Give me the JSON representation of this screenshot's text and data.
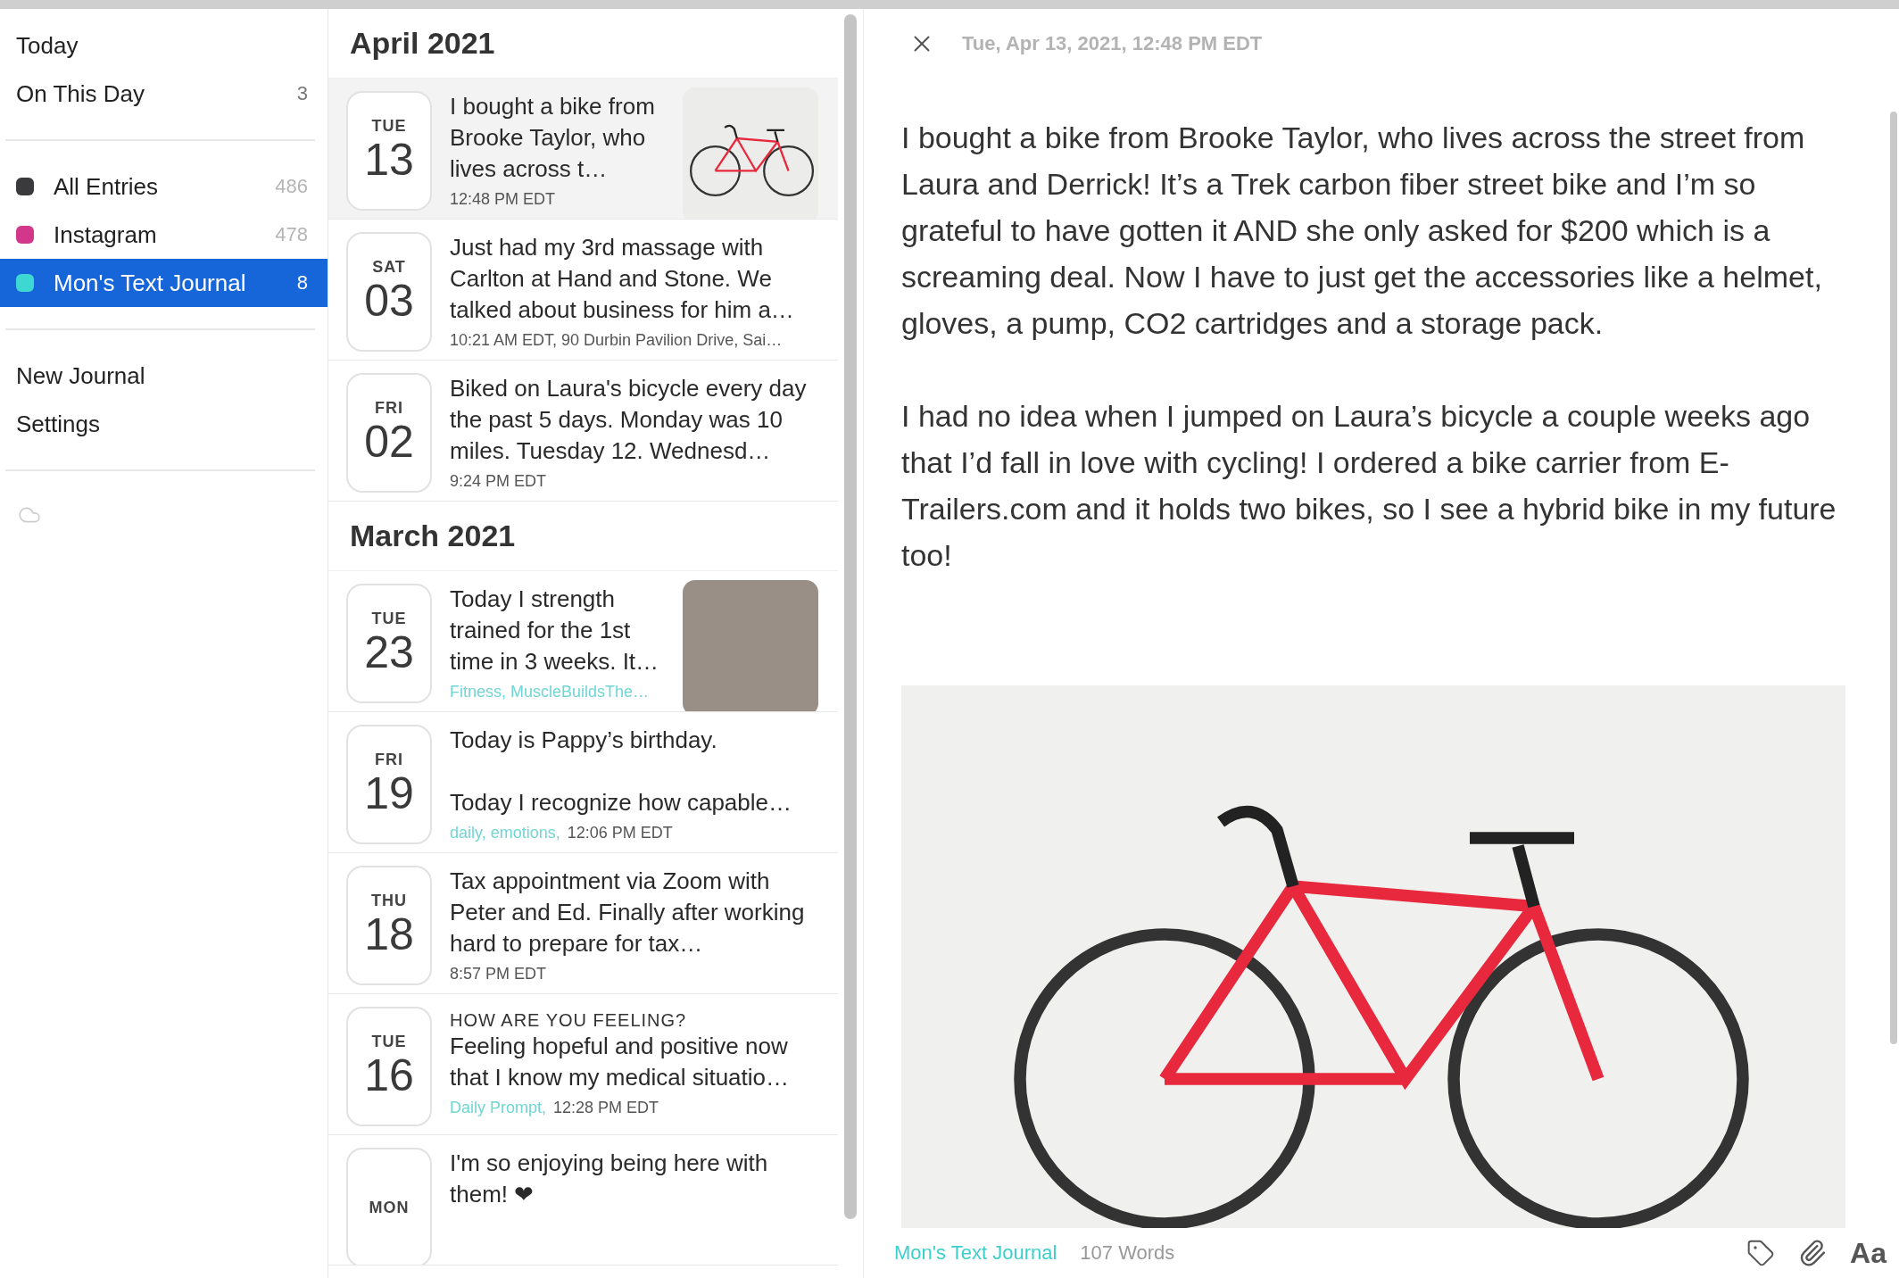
{
  "sidebar": {
    "top_items": [
      {
        "label": "Today"
      },
      {
        "label": "On This Day",
        "count": "3"
      }
    ],
    "journals": [
      {
        "name": "All Entries",
        "count": "486",
        "color": "#3a3a3c",
        "selected": false
      },
      {
        "name": "Instagram",
        "count": "478",
        "color": "#d2378c",
        "selected": false
      },
      {
        "name": "Mon's Text Journal",
        "count": "8",
        "color": "#3dd8d2",
        "selected": true
      }
    ],
    "actions": [
      {
        "label": "New Journal"
      },
      {
        "label": "Settings"
      }
    ]
  },
  "entry_list": {
    "sections": [
      {
        "month": "April 2021",
        "entries": [
          {
            "weekday": "TUE",
            "day": "13",
            "text": "I bought a bike from Brooke Taylor, who lives across t…",
            "meta": "12:48 PM EDT",
            "thumbnail": {
              "kind": "bike"
            },
            "selected": true
          },
          {
            "weekday": "SAT",
            "day": "03",
            "text": "Just had my 3rd massage with Carlton at Hand and Stone.  We talked about business for him a…",
            "meta": "10:21 AM EDT,  90 Durbin Pavilion Drive, Sai…",
            "selected": false
          },
          {
            "weekday": "FRI",
            "day": "02",
            "text": "Biked on Laura's bicycle every day the past 5 days. Monday was 10 miles. Tuesday 12. Wednesd…",
            "meta": "9:24 PM EDT",
            "selected": false
          }
        ]
      },
      {
        "month": "March 2021",
        "entries": [
          {
            "weekday": "TUE",
            "day": "23",
            "text": "Today I strength trained for the 1st time in 3 weeks. It…",
            "tags": "Fitness, MuscleBuildsThe…",
            "thumbnail": {
              "kind": "photo"
            },
            "selected": false
          },
          {
            "weekday": "FRI",
            "day": "19",
            "text": "Today is Pappy’s birthday.\n\nToday I recognize how capable…",
            "tags": "daily, emotions,",
            "meta": "12:06 PM EDT",
            "selected": false
          },
          {
            "weekday": "THU",
            "day": "18",
            "text": "Tax appointment via Zoom with Peter and Ed. Finally after working hard to prepare for tax…",
            "meta": "8:57 PM EDT",
            "selected": false
          },
          {
            "weekday": "TUE",
            "day": "16",
            "prompt": "HOW ARE YOU FEELING?",
            "text": "Feeling hopeful and positive now that I know my medical situatio…",
            "tags": "Daily Prompt,",
            "meta": "12:28 PM EDT",
            "selected": false
          },
          {
            "weekday": "MON",
            "text": "I'm so enjoying being here with them! ❤",
            "selected": false
          }
        ]
      }
    ]
  },
  "detail": {
    "date": "Tue, Apr 13, 2021, 12:48 PM EDT",
    "paragraphs": [
      "I bought a bike from Brooke Taylor, who lives across the street from Laura and Derrick! It’s a Trek carbon fiber street bike and I’m so grateful to have gotten it AND she  only asked for $200 which is a screaming deal. Now I have to just get the accessories like a helmet, gloves, a pump, CO2 cartridges and a storage pack.",
      "I had no idea when I jumped on Laura’s bicycle a couple weeks ago that I’d fall in love with cycling! I ordered a bike carrier from E-Trailers.com and it holds two bikes, so I see a hybrid bike in my future too!"
    ],
    "photo": {
      "kind": "bike"
    },
    "footer": {
      "journal": "Mon's Text Journal",
      "word_count": "107 Words",
      "font_button": "Aa"
    }
  }
}
